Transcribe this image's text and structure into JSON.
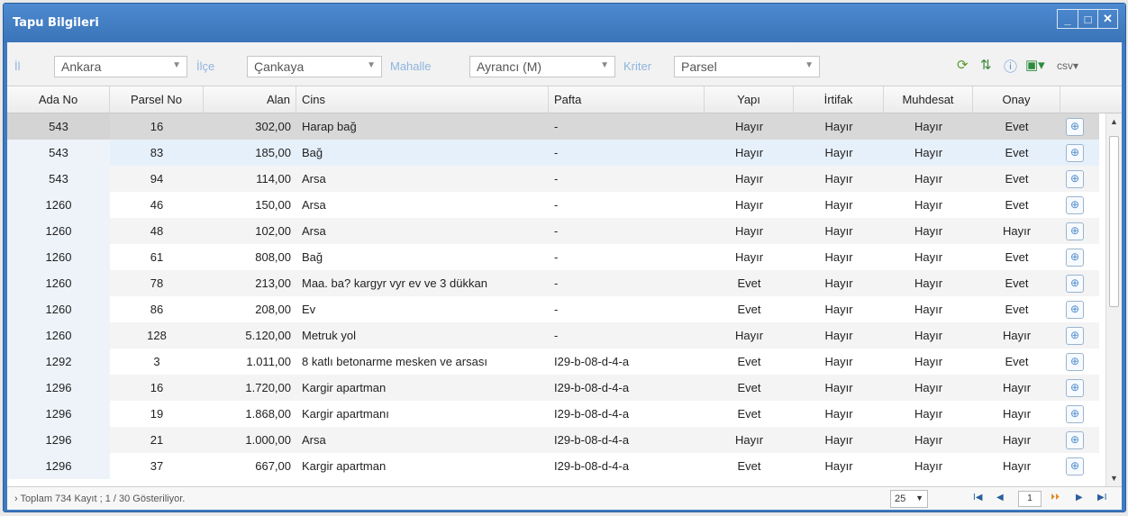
{
  "window": {
    "title": "Tapu Bilgileri"
  },
  "toolbar": {
    "il_label": "İl",
    "il_value": "Ankara",
    "ilce_label": "İlçe",
    "ilce_value": "Çankaya",
    "mahalle_label": "Mahalle",
    "mahalle_value": "Ayrancı (M)",
    "kriter_label": "Kriter",
    "kriter_value": "Parsel"
  },
  "table": {
    "columns": [
      "Ada No",
      "Parsel No",
      "Alan",
      "Cins",
      "Pafta",
      "Yapı",
      "İrtifak",
      "Muhdesat",
      "Onay"
    ],
    "rows": [
      [
        "543",
        "16",
        "302,00",
        "Harap bağ",
        "-",
        "Hayır",
        "Hayır",
        "Hayır",
        "Evet"
      ],
      [
        "543",
        "83",
        "185,00",
        "Bağ",
        "-",
        "Hayır",
        "Hayır",
        "Hayır",
        "Evet"
      ],
      [
        "543",
        "94",
        "114,00",
        "Arsa",
        "-",
        "Hayır",
        "Hayır",
        "Hayır",
        "Evet"
      ],
      [
        "1260",
        "46",
        "150,00",
        "Arsa",
        "-",
        "Hayır",
        "Hayır",
        "Hayır",
        "Evet"
      ],
      [
        "1260",
        "48",
        "102,00",
        "Arsa",
        "-",
        "Hayır",
        "Hayır",
        "Hayır",
        "Hayır"
      ],
      [
        "1260",
        "61",
        "808,00",
        "Bağ",
        "-",
        "Hayır",
        "Hayır",
        "Hayır",
        "Evet"
      ],
      [
        "1260",
        "78",
        "213,00",
        "Maa. ba?  kargyr vyr ev ve 3 dükkan",
        "-",
        "Evet",
        "Hayır",
        "Hayır",
        "Evet"
      ],
      [
        "1260",
        "86",
        "208,00",
        "Ev",
        "-",
        "Evet",
        "Hayır",
        "Hayır",
        "Evet"
      ],
      [
        "1260",
        "128",
        "5.120,00",
        "Metruk yol",
        "-",
        "Hayır",
        "Hayır",
        "Hayır",
        "Hayır"
      ],
      [
        "1292",
        "3",
        "1.011,00",
        "8 katlı betonarme mesken ve arsası",
        "I29-b-08-d-4-a",
        "Evet",
        "Hayır",
        "Hayır",
        "Evet"
      ],
      [
        "1296",
        "16",
        "1.720,00",
        "Kargir apartman",
        "I29-b-08-d-4-a",
        "Evet",
        "Hayır",
        "Hayır",
        "Hayır"
      ],
      [
        "1296",
        "19",
        "1.868,00",
        "Kargir apartmanı",
        "I29-b-08-d-4-a",
        "Evet",
        "Hayır",
        "Hayır",
        "Hayır"
      ],
      [
        "1296",
        "21",
        "1.000,00",
        "Arsa",
        "I29-b-08-d-4-a",
        "Hayır",
        "Hayır",
        "Hayır",
        "Hayır"
      ],
      [
        "1296",
        "37",
        "667,00",
        "Kargir apartman",
        "I29-b-08-d-4-a",
        "Evet",
        "Hayır",
        "Hayır",
        "Hayır"
      ]
    ]
  },
  "pager": {
    "info": "Toplam 734 Kayıt ; 1 / 30 Gösteriliyor.",
    "page_size": "25",
    "page": "1"
  },
  "icons": [
    "refresh-icon",
    "sort-icon",
    "info-icon",
    "excel-export-icon",
    "csv-export-icon",
    "zoom-icon"
  ]
}
